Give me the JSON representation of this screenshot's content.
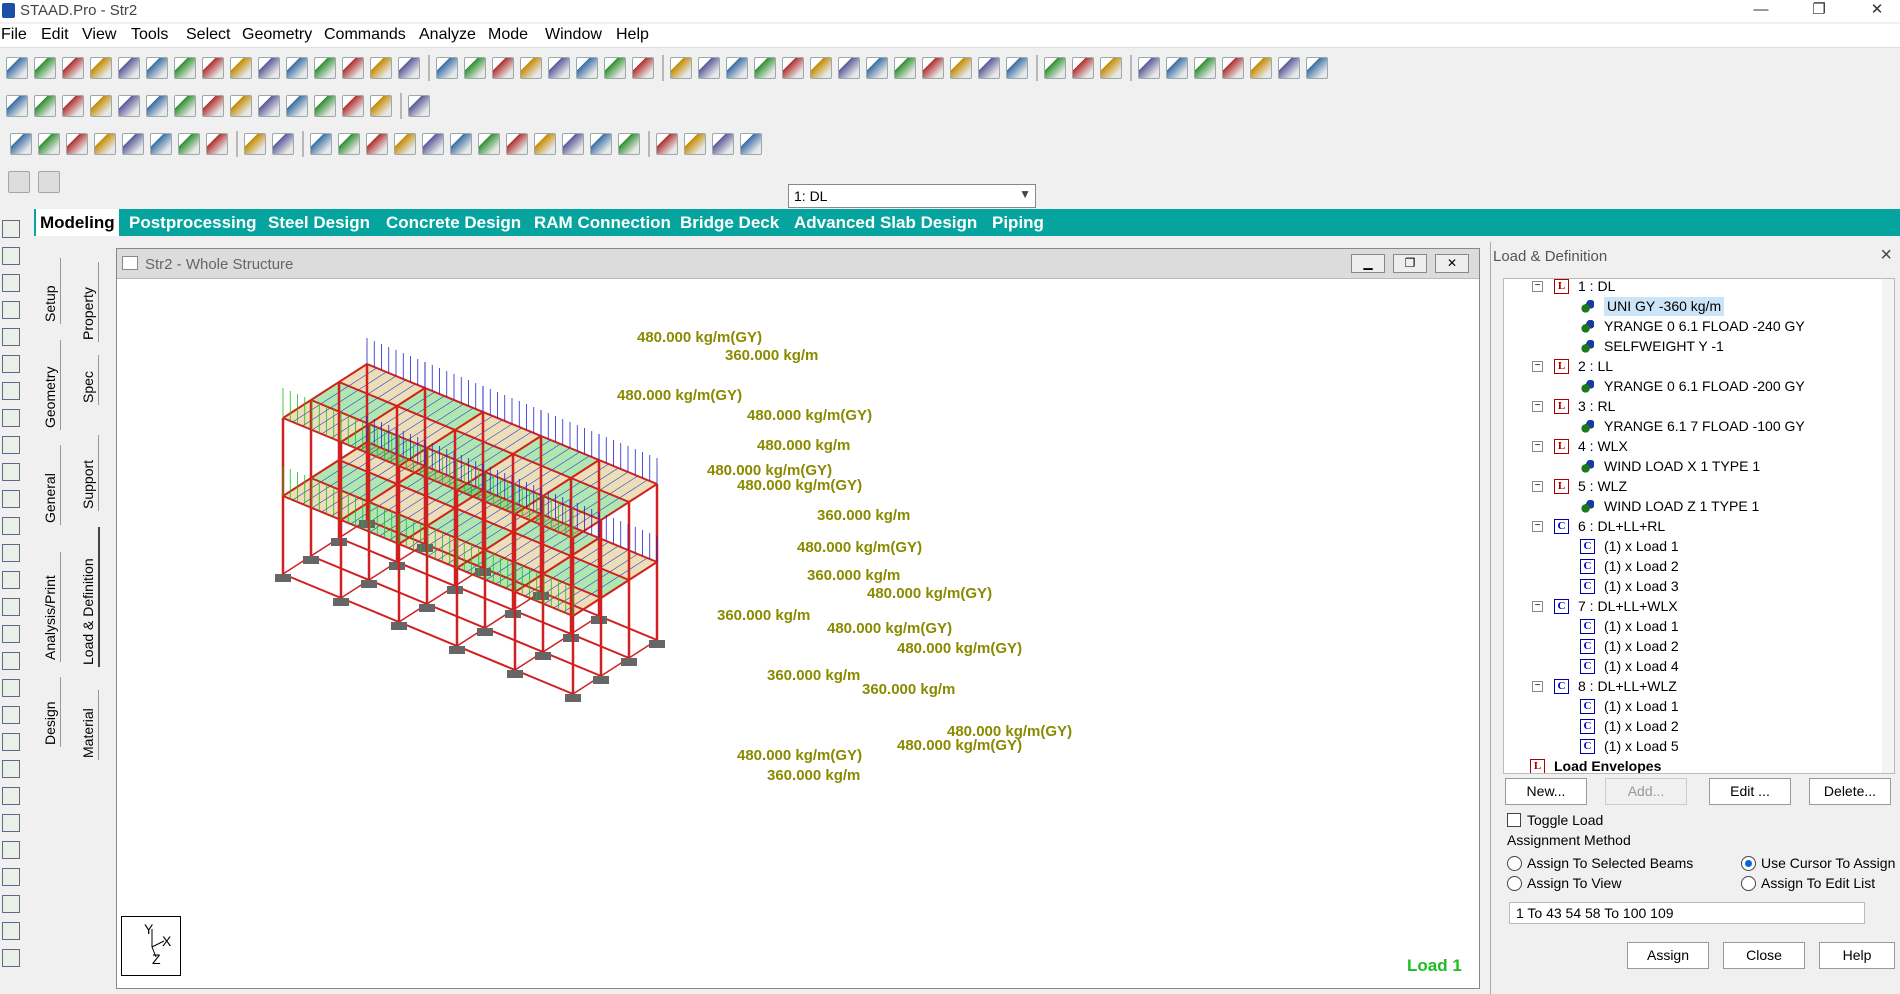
{
  "window": {
    "title": "STAAD.Pro - Str2"
  },
  "menu": [
    "File",
    "Edit",
    "View",
    "Tools",
    "Select",
    "Geometry",
    "Commands",
    "Analyze",
    "Mode",
    "Window",
    "Help"
  ],
  "toolbar": {
    "load_case_select": "1: DL"
  },
  "page_tabs": [
    "Modeling",
    "Postprocessing",
    "Steel Design",
    "Concrete Design",
    "RAM Connection",
    "Bridge Deck",
    "Advanced Slab Design",
    "Piping"
  ],
  "side_tabs_outer": [
    "Setup",
    "Geometry",
    "General",
    "Analysis/Print",
    "Design"
  ],
  "side_tabs_inner": [
    "Property",
    "Spec",
    "Support",
    "Load & Definition",
    "Material"
  ],
  "view": {
    "title": "Str2 - Whole Structure",
    "status_label": "Load 1",
    "axis": {
      "y": "Y",
      "x": "X",
      "z": "Z"
    },
    "load_labels": [
      "480.000 kg/m(GY)",
      "360.000 kg/m",
      "480.000 kg/m(GY)",
      "480.000 kg/m(GY)",
      "480.000 kg/m",
      "480.000 kg/m(GY)",
      "480.000 kg/m(GY)",
      "360.000 kg/m",
      "480.000 kg/m(GY)",
      "360.000 kg/m",
      "480.000 kg/m(GY)",
      "360.000 kg/m",
      "480.000 kg/m(GY)",
      "480.000 kg/m(GY)",
      "360.000 kg/m",
      "360.000 kg/m",
      "480.000 kg/m(GY)",
      "480.000 kg/m(GY)",
      "480.000 kg/m(GY)",
      "360.000 kg/m"
    ]
  },
  "panel": {
    "title": "Load & Definition",
    "tree": [
      {
        "type": "L",
        "label": "1 : DL",
        "children": [
          "UNI GY -360 kg/m",
          "YRANGE 0 6.1 FLOAD -240 GY",
          "SELFWEIGHT Y -1"
        ]
      },
      {
        "type": "L",
        "label": "2 : LL",
        "children": [
          "YRANGE 0 6.1 FLOAD -200 GY"
        ]
      },
      {
        "type": "L",
        "label": "3 : RL",
        "children": [
          "YRANGE 6.1 7 FLOAD -100 GY"
        ]
      },
      {
        "type": "L",
        "label": "4 : WLX",
        "children": [
          "WIND LOAD X 1 TYPE 1"
        ]
      },
      {
        "type": "L",
        "label": "5 : WLZ",
        "children": [
          "WIND LOAD Z 1 TYPE 1"
        ]
      },
      {
        "type": "C",
        "label": "6 : DL+LL+RL",
        "children": [
          "(1) x Load 1",
          "(1) x Load 2",
          "(1) x Load 3"
        ]
      },
      {
        "type": "C",
        "label": "7 : DL+LL+WLX",
        "children": [
          "(1) x Load 1",
          "(1) x Load 2",
          "(1) x Load 4"
        ]
      },
      {
        "type": "C",
        "label": "8 : DL+LL+WLZ",
        "children": [
          "(1) x Load 1",
          "(1) x Load 2",
          "(1) x Load 5"
        ]
      }
    ],
    "envelopes_label": "Load Envelopes",
    "buttons": {
      "new": "New...",
      "add": "Add...",
      "edit": "Edit ...",
      "delete": "Delete..."
    },
    "toggle_load": "Toggle Load",
    "assignment_method": "Assignment Method",
    "radios": {
      "selected_beams": "Assign To Selected Beams",
      "use_cursor": "Use Cursor To Assign",
      "view": "Assign To View",
      "edit_list": "Assign To Edit List"
    },
    "edit_list_value": "1 To 43 54 58 To 100 109",
    "footer": {
      "assign": "Assign",
      "close": "Close",
      "help": "Help"
    }
  }
}
